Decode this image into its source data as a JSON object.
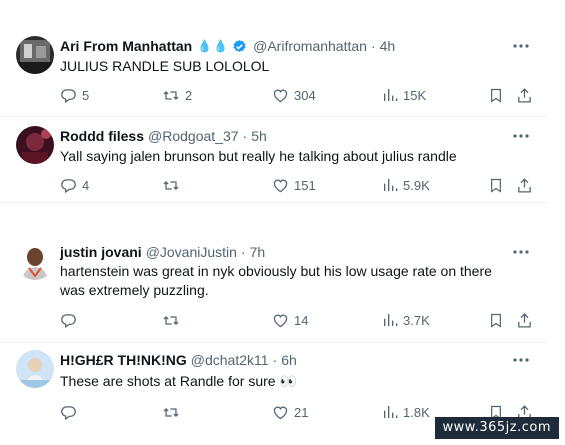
{
  "tweets": [
    {
      "display_name": "Ari From Manhattan",
      "badges": "💧💧",
      "handle": "@Arifromanhattan",
      "separator": "·",
      "time": "4h",
      "text": "JULIUS RANDLE SUB LOLOLOL",
      "replies": "5",
      "retweets": "2",
      "likes": "304",
      "views": "15K",
      "verified": true
    },
    {
      "display_name": "Roddd filess",
      "handle": "@Rodgoat_37",
      "separator": "·",
      "time": "5h",
      "text": "Yall saying jalen brunson but really he talking about julius randle",
      "replies": "4",
      "retweets": "",
      "likes": "151",
      "views": "5.9K"
    },
    {
      "display_name": "justin jovani",
      "handle": "@JovaniJustin",
      "separator": "·",
      "time": "7h",
      "text": "hartenstein was great in nyk obviously but his low usage rate on there was extremely puzzling.",
      "replies": "",
      "retweets": "",
      "likes": "14",
      "views": "3.7K"
    },
    {
      "display_name": "H!GH£R TH!NK!NG",
      "handle": "@dchat2k11",
      "separator": "·",
      "time": "6h",
      "text": "These are shots at Randle for sure 👀",
      "replies": "",
      "retweets": "",
      "likes": "21",
      "views": "1.8K"
    }
  ],
  "watermark": "www.365jz.com",
  "colors": {
    "text_primary": "#0f1419",
    "text_secondary": "#536471",
    "verified_blue": "#1d9bf0",
    "divider": "#eff3f4"
  },
  "icons": [
    "more-icon",
    "reply-icon",
    "retweet-icon",
    "like-icon",
    "views-icon",
    "bookmark-icon",
    "share-icon",
    "verified-icon",
    "droplet-icon"
  ]
}
